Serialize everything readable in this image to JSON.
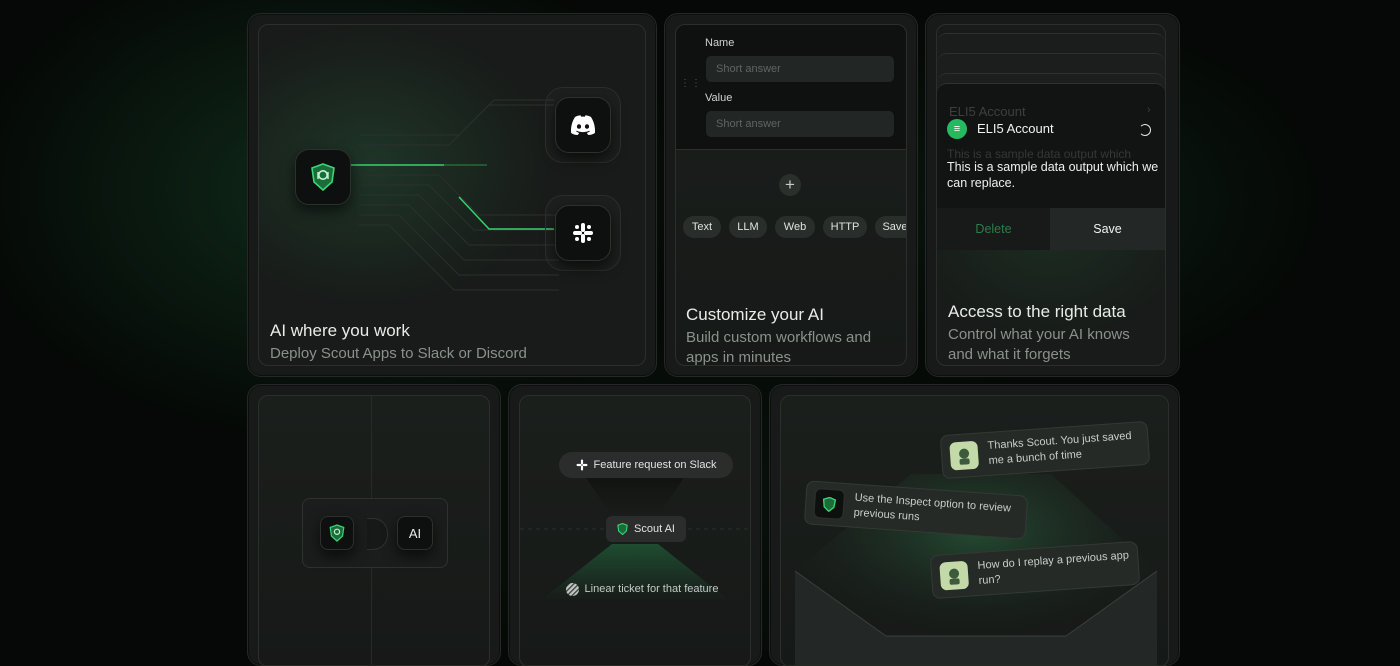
{
  "card1": {
    "title": "AI where you work",
    "subtitle": "Deploy Scout Apps to Slack or Discord",
    "icons": [
      "scout-shield-icon",
      "discord-icon",
      "slack-icon"
    ]
  },
  "card2": {
    "fields": [
      {
        "label": "Name",
        "placeholder": "Short answer"
      },
      {
        "label": "Value",
        "placeholder": "Short answer"
      }
    ],
    "add_glyph": "+",
    "chips": [
      "Text",
      "LLM",
      "Web",
      "HTTP",
      "Save"
    ],
    "title": "Customize your AI",
    "subtitle": "Build custom workflows and apps in minutes"
  },
  "card3": {
    "ghost_account": "ELI5 Account",
    "ghost_text": "This is a sample data output which",
    "account": "ELI5 Account",
    "output": "This is a sample data output which we can replace.",
    "delete_label": "Delete",
    "save_label": "Save",
    "title": "Access to the right data",
    "subtitle": "Control what your AI knows and what it forgets"
  },
  "card4": {
    "ai_label": "AI"
  },
  "card5": {
    "top_pill": "Feature request on Slack",
    "middle_pill": "Scout AI",
    "bottom_pill": "Linear ticket for that feature"
  },
  "card6": {
    "bubble1": "Thanks Scout. You just saved me a bunch of time",
    "bubble2": "Use the Inspect option to review previous runs",
    "bubble3": "How do I replay a previous app run?"
  },
  "colors": {
    "accent": "#2fd36b",
    "card": "#171a18",
    "background": "#050806"
  }
}
